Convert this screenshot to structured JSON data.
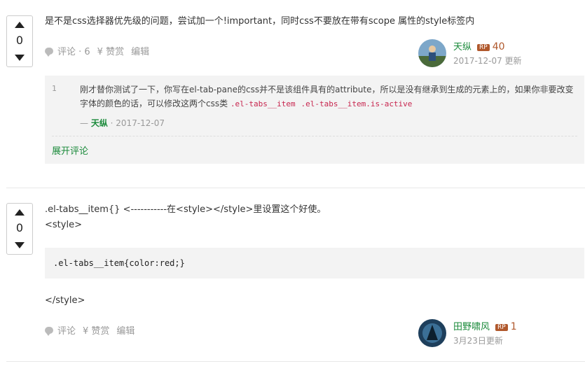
{
  "answer1": {
    "votes": "0",
    "text": "是不是css选择器优先级的问题，尝试加一个!important，同时css不要放在带有scope 属性的style标签内",
    "actions": {
      "comment": "评论 · 6",
      "reward": "¥ 赞赏",
      "edit": "编辑"
    },
    "author": {
      "name": "天纵",
      "rp_badge": "RP",
      "reputation": "40",
      "updated": "2017-12-07 更新"
    },
    "comments": [
      {
        "number": "1",
        "text": "刚才替你测试了一下，你写在el-tab-pane的css并不是该组件具有的attribute，所以是没有继承到生成的元素上的，如果你非要改变字体的颜色的话，可以修改这两个css类",
        "code1": ".el-tabs__item",
        "code2": ".el-tabs__item.is-active",
        "author_prefix": "— ",
        "author": "天纵",
        "date": " · 2017-12-07"
      }
    ],
    "expand_label": "展开评论"
  },
  "answer2": {
    "votes": "0",
    "line1": ".el-tabs__item{} <-----------在<style></style>里设置这个好使。",
    "line2": "<style>",
    "code": ".el-tabs__item{color:red;}",
    "line3": "</style>",
    "actions": {
      "comment": "评论",
      "reward": "¥ 赞赏",
      "edit": "编辑"
    },
    "author": {
      "name": "田野啸风",
      "rp_badge": "RP",
      "reputation": "1",
      "updated": "3月23日更新"
    }
  }
}
